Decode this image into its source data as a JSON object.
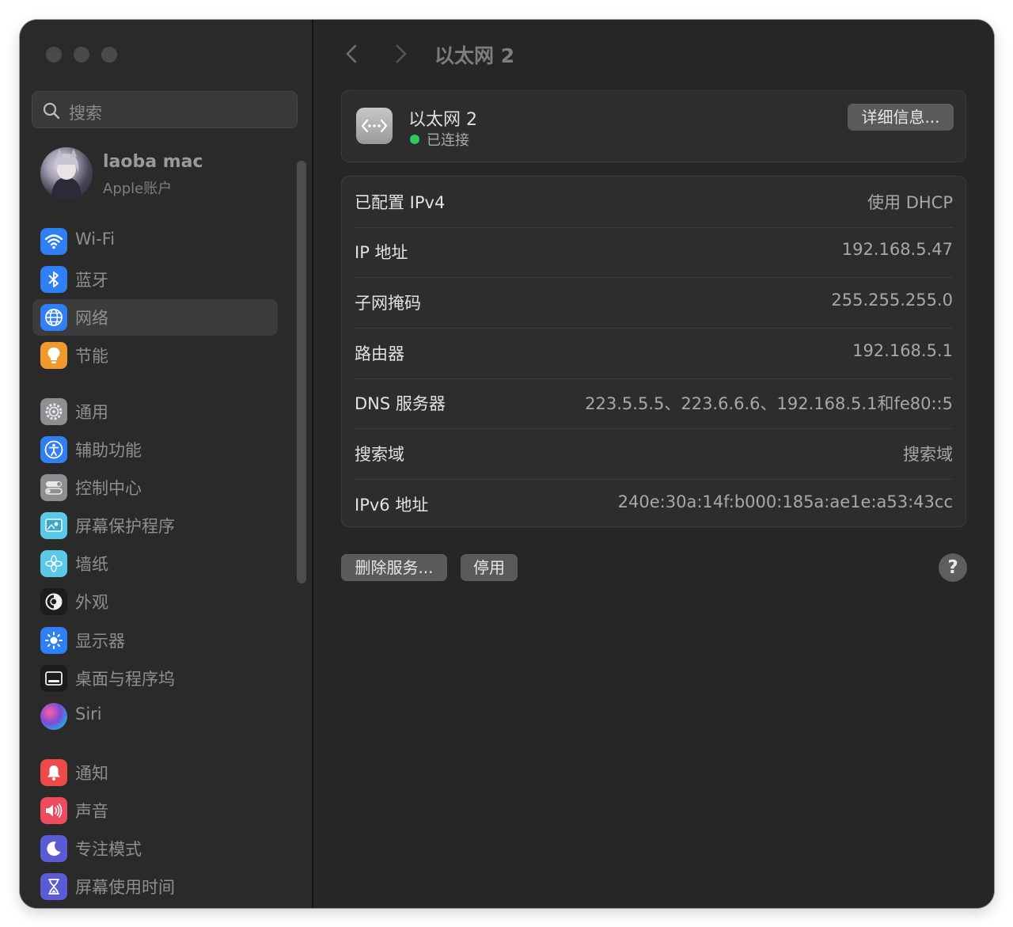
{
  "window": {
    "title": "以太网 2"
  },
  "sidebar": {
    "search_placeholder": "搜索",
    "account": {
      "name": "laoba mac",
      "subtitle": "Apple账户"
    },
    "items": [
      {
        "label": "Wi-Fi",
        "icon": "wifi-icon",
        "color": "#2f7ff6"
      },
      {
        "label": "蓝牙",
        "icon": "bluetooth-icon",
        "color": "#2f7ff6"
      },
      {
        "label": "网络",
        "icon": "globe-icon",
        "color": "#2f7ff6",
        "selected": true
      },
      {
        "label": "节能",
        "icon": "lightbulb-icon",
        "color": "#f09a2e"
      },
      {
        "label": "通用",
        "icon": "gear-icon",
        "color": "#8e8e93"
      },
      {
        "label": "辅助功能",
        "icon": "accessibility-icon",
        "color": "#2f7ff6"
      },
      {
        "label": "控制中心",
        "icon": "control-center-icon",
        "color": "#8e8e93"
      },
      {
        "label": "屏幕保护程序",
        "icon": "screensaver-icon",
        "color": "#5ac8e6"
      },
      {
        "label": "墙纸",
        "icon": "wallpaper-icon",
        "color": "#5ac8e6"
      },
      {
        "label": "外观",
        "icon": "appearance-icon",
        "color": "#1c1c1e"
      },
      {
        "label": "显示器",
        "icon": "display-icon",
        "color": "#2f7ff6"
      },
      {
        "label": "桌面与程序坞",
        "icon": "dock-icon",
        "color": "#1c1c1e"
      },
      {
        "label": "Siri",
        "icon": "siri-icon",
        "color": "#7a4bd6"
      },
      {
        "label": "通知",
        "icon": "bell-icon",
        "color": "#ef4a4a"
      },
      {
        "label": "声音",
        "icon": "speaker-icon",
        "color": "#ef4a5f"
      },
      {
        "label": "专注模式",
        "icon": "moon-icon",
        "color": "#5b5bd6"
      },
      {
        "label": "屏幕使用时间",
        "icon": "hourglass-icon",
        "color": "#5b5bd6"
      }
    ]
  },
  "service": {
    "name": "以太网 2",
    "status": "已连接",
    "details_button": "详细信息..."
  },
  "details": [
    {
      "key": "已配置 IPv4",
      "value": "使用 DHCP"
    },
    {
      "key": "IP 地址",
      "value": "192.168.5.47"
    },
    {
      "key": "子网掩码",
      "value": "255.255.255.0"
    },
    {
      "key": "路由器",
      "value": "192.168.5.1"
    },
    {
      "key": "DNS 服务器",
      "value": "223.5.5.5、223.6.6.6、192.168.5.1和fe80::5"
    },
    {
      "key": "搜索域",
      "value": "搜索域"
    },
    {
      "key": "IPv6 地址",
      "value": "240e:30a:14f:b000:185a:ae1e:a53:43cc"
    }
  ],
  "actions": {
    "remove_service": "删除服务...",
    "disable": "停用",
    "help": "?"
  }
}
